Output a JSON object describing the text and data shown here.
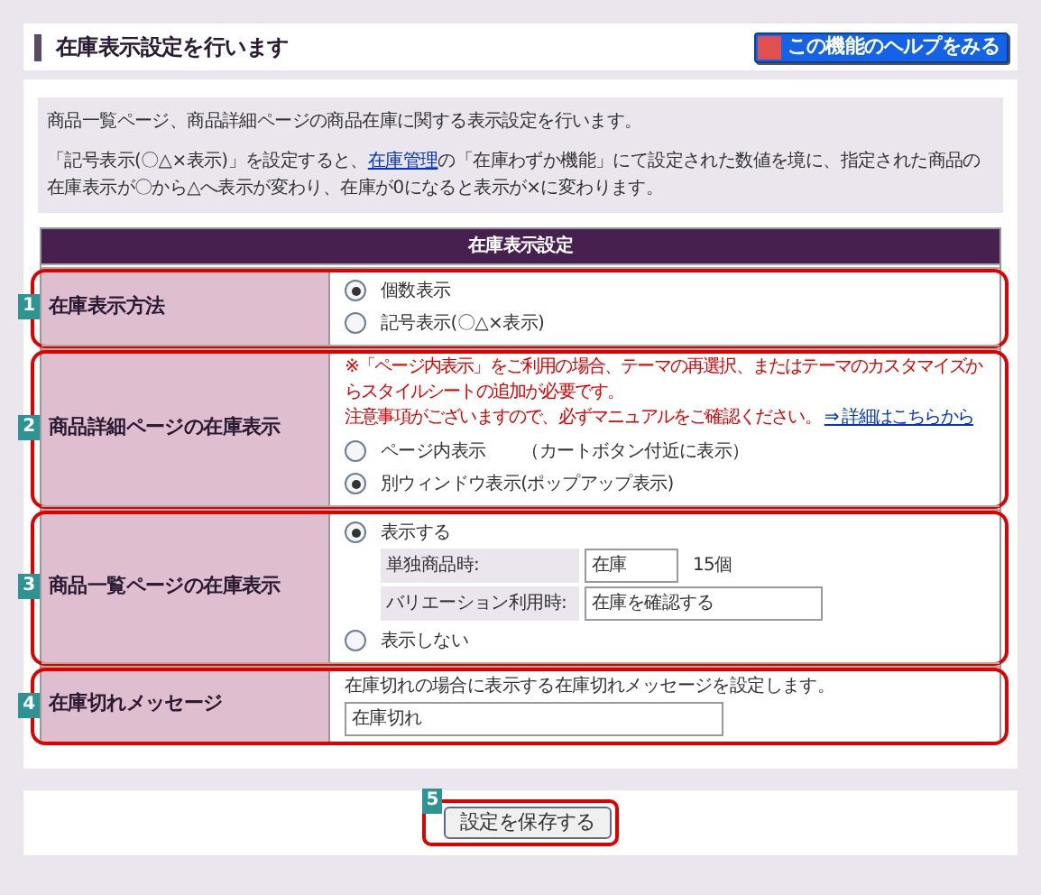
{
  "header": {
    "title": "在庫表示設定を行います",
    "help_button": "この機能のヘルプをみる"
  },
  "intro": {
    "line1": "商品一覧ページ、商品詳細ページの商品在庫に関する表示設定を行います。",
    "line2_before": "「記号表示(〇△×表示)」を設定すると、",
    "line2_link": "在庫管理",
    "line2_after": "の「在庫わずか機能」にて設定された数値を境に、指定された商品の在庫表示が〇から△へ表示が変わり、在庫が0になると表示が×に変わります。"
  },
  "table": {
    "title": "在庫表示設定",
    "rows": [
      {
        "kind": "radio",
        "badge": "1",
        "label": "在庫表示方法",
        "options": [
          {
            "label": "個数表示",
            "selected": true
          },
          {
            "label": "記号表示(〇△×表示)",
            "selected": false
          }
        ]
      },
      {
        "kind": "radio_notice",
        "badge": "2",
        "label": "商品詳細ページの在庫表示",
        "notice": "※「ページ内表示」をご利用の場合、テーマの再選択、またはテーマのカスタマイズからスタイルシートの追加が必要です。",
        "notice2": "注意事項がございますので、必ずマニュアルをご確認ください。",
        "link": "⇒ 詳細はこちらから",
        "options": [
          {
            "label": "ページ内表示",
            "note": "（カートボタン付近に表示）",
            "selected": false
          },
          {
            "label": "別ウィンドウ表示(ポップアップ表示)",
            "selected": true
          }
        ]
      },
      {
        "kind": "radio_fields",
        "badge": "3",
        "label": "商品一覧ページの在庫表示",
        "options": [
          {
            "label": "表示する",
            "selected": true,
            "fields": [
              {
                "label": "単独商品時:",
                "value": "在庫",
                "suffix": "15個"
              },
              {
                "label": "バリエーション利用時:",
                "value": "在庫を確認する"
              }
            ]
          },
          {
            "label": "表示しない",
            "selected": false
          }
        ]
      },
      {
        "kind": "text_field",
        "badge": "4",
        "label": "在庫切れメッセージ",
        "description": "在庫切れの場合に表示する在庫切れメッセージを設定します。",
        "value": "在庫切れ"
      }
    ]
  },
  "save": {
    "badge": "5",
    "label": "設定を保存する"
  }
}
